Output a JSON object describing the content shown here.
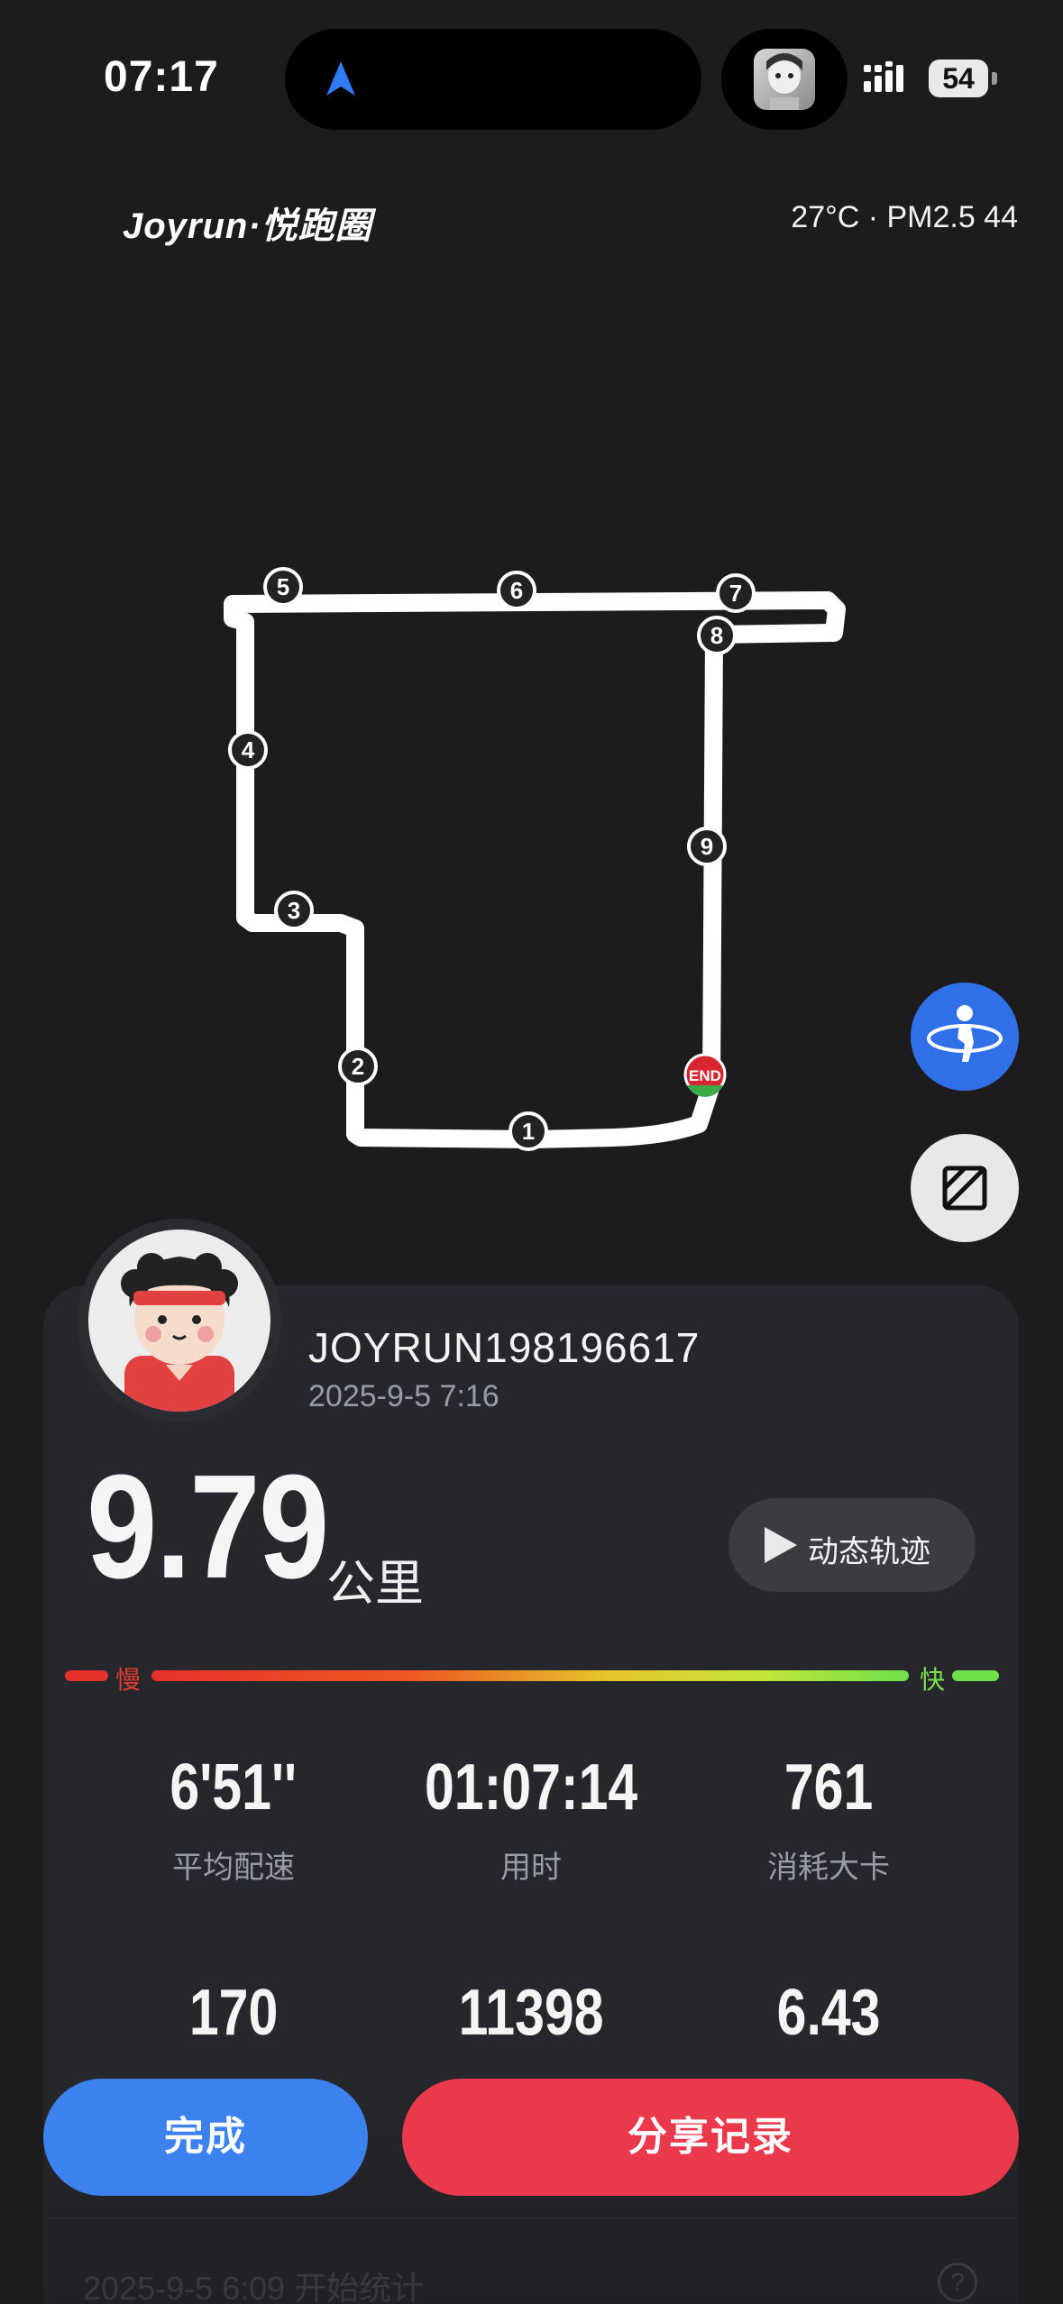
{
  "status_bar": {
    "time": "07:17",
    "battery": "54",
    "icons": [
      "navigation-arrow-icon",
      "signal-icon",
      "battery-icon"
    ]
  },
  "header": {
    "brand": "Joyrun·悦跑圈",
    "weather": "27°C · PM2.5 44"
  },
  "map": {
    "markers": [
      "1",
      "2",
      "3",
      "4",
      "5",
      "6",
      "7",
      "8",
      "9"
    ],
    "end_label": "END"
  },
  "user": {
    "name": "JOYRUN198196617",
    "datetime": "2025-9-5 7:16"
  },
  "run": {
    "distance": "9.79",
    "distance_unit": "公里",
    "track_button": "动态轨迹",
    "pace_slow": "慢",
    "pace_fast": "快"
  },
  "stats": [
    {
      "value": "6'51''",
      "label": "平均配速"
    },
    {
      "value": "01:07:14",
      "label": "用时"
    },
    {
      "value": "761",
      "label": "消耗大卡"
    },
    {
      "value": "170",
      "label": ""
    },
    {
      "value": "11398",
      "label": ""
    },
    {
      "value": "6.43",
      "label": ""
    }
  ],
  "actions": {
    "done": "完成",
    "share": "分享记录"
  },
  "footer": {
    "text": "2025-9-5 6:09 开始统计"
  },
  "colors": {
    "background": "#1c1c1e",
    "card": "#25272c",
    "primary_blue": "#3b82ee",
    "share_red": "#e9394a",
    "pace_slow": "#e83a2f",
    "pace_fast": "#7ee14a"
  }
}
